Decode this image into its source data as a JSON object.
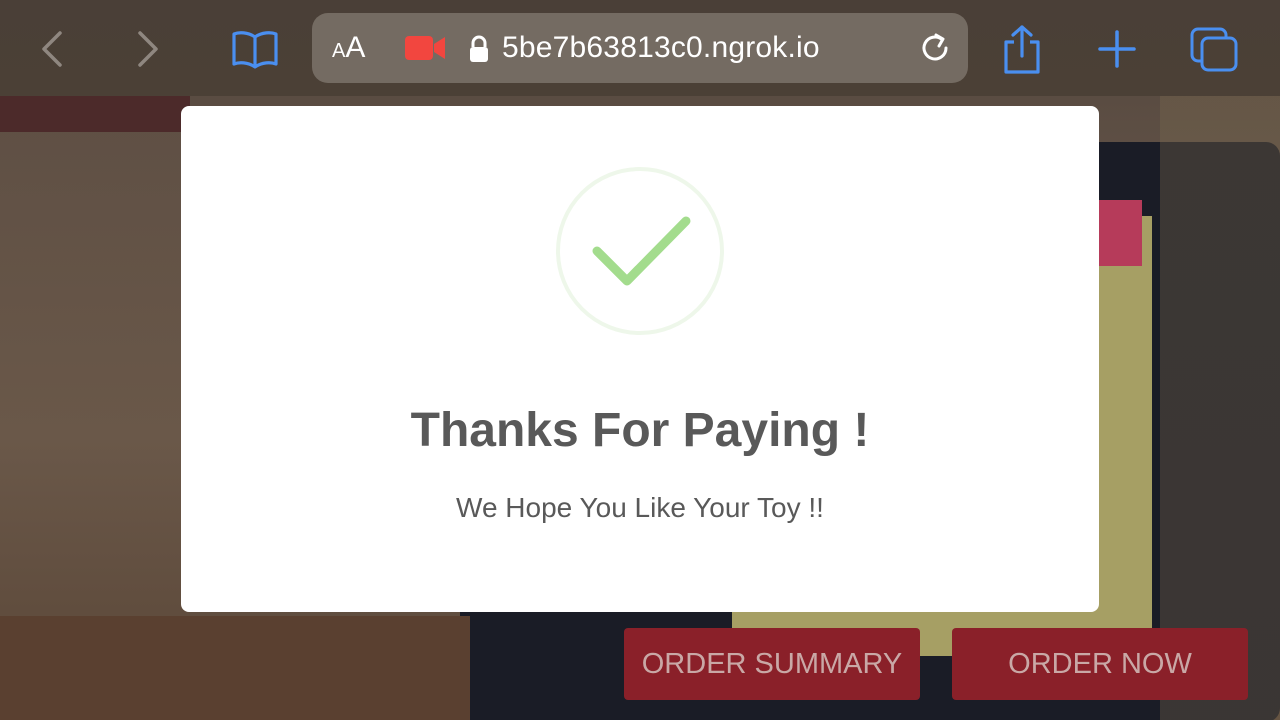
{
  "browser": {
    "text_size_label_small": "A",
    "text_size_label_large": "A",
    "url": "5be7b63813c0.ngrok.io",
    "icons": [
      "back-icon",
      "forward-icon",
      "bookmarks-icon",
      "camera-icon",
      "lock-icon",
      "reload-icon",
      "share-icon",
      "new-tab-icon",
      "tabs-icon"
    ],
    "accent": "#4a8ff0",
    "camera_color": "#f2463f"
  },
  "modal": {
    "title": "Thanks For Paying !",
    "message": "We Hope You Like Your Toy !!",
    "check_color": "#a3dc8d",
    "ring_color": "#eef7ea"
  },
  "actions": {
    "order_summary": "ORDER SUMMARY",
    "order_now": "ORDER NOW",
    "button_color": "#8a2029"
  }
}
